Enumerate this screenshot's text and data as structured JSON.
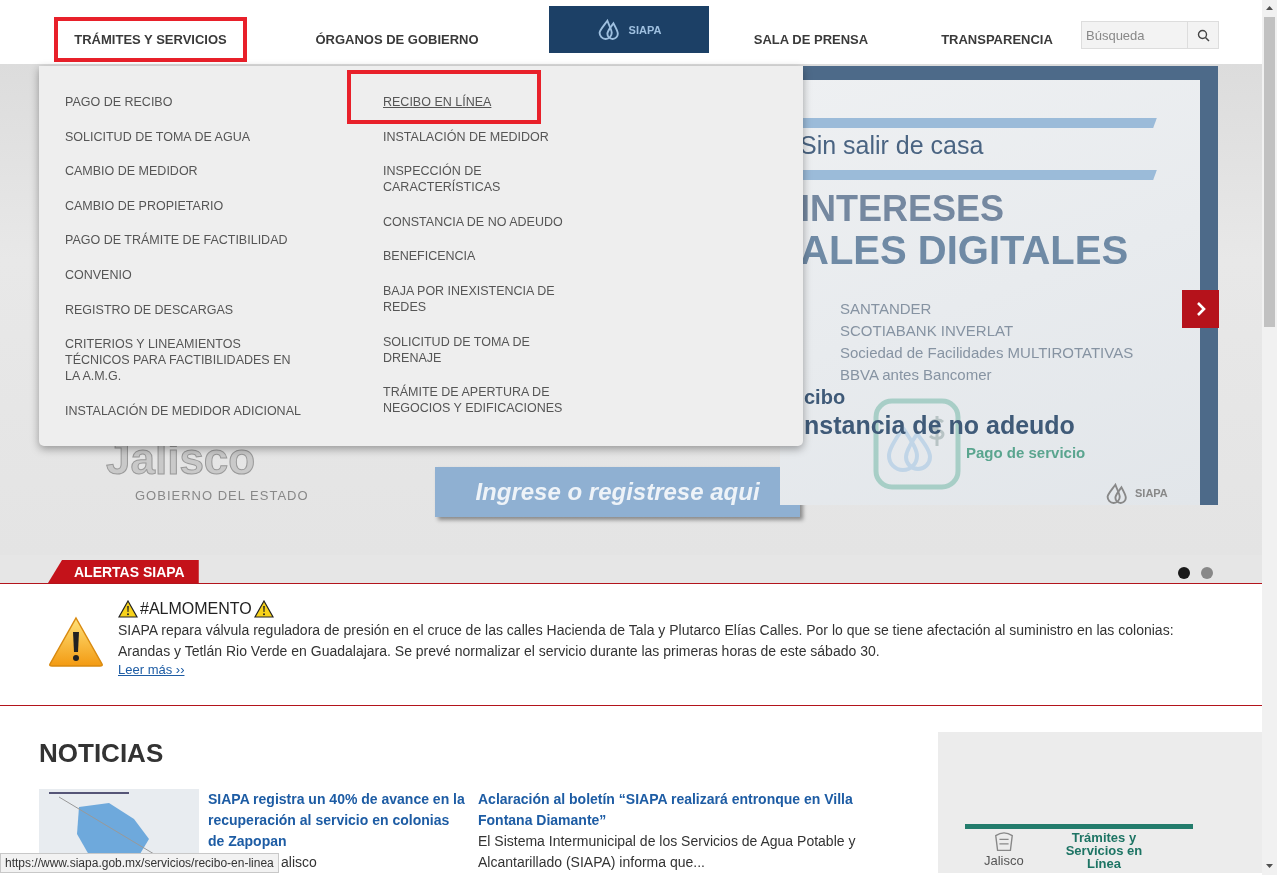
{
  "header": {
    "nav_left": [
      {
        "label": "TRÁMITES Y SERVICIOS",
        "highlighted": true
      },
      {
        "label": "ÓRGANOS DE GOBIERNO",
        "highlighted": false
      }
    ],
    "logo": {
      "text": "SIAPA"
    },
    "nav_right": [
      {
        "label": "SALA DE PRENSA",
        "highlighted": false
      },
      {
        "label": "TRANSPARENCIA",
        "highlighted": false
      }
    ],
    "search": {
      "placeholder": "Búsqueda"
    }
  },
  "dropdown_menu": {
    "columns": [
      [
        {
          "label": "PAGO DE RECIBO",
          "highlighted": false,
          "hovered": false
        },
        {
          "label": "SOLICITUD DE TOMA DE AGUA",
          "highlighted": false,
          "hovered": false
        },
        {
          "label": "CAMBIO DE MEDIDOR",
          "highlighted": false,
          "hovered": false
        },
        {
          "label": "CAMBIO DE PROPIETARIO",
          "highlighted": false,
          "hovered": false
        },
        {
          "label": "PAGO DE TRÁMITE DE FACTIBILIDAD",
          "highlighted": false,
          "hovered": false
        },
        {
          "label": "CONVENIO",
          "highlighted": false,
          "hovered": false
        },
        {
          "label": "REGISTRO DE DESCARGAS",
          "highlighted": false,
          "hovered": false
        },
        {
          "label": "CRITERIOS Y LINEAMIENTOS TÉCNICOS PARA FACTIBILIDADES EN LA A.M.G.",
          "highlighted": false,
          "hovered": false
        },
        {
          "label": "INSTALACIÓN DE MEDIDOR ADICIONAL",
          "highlighted": false,
          "hovered": false
        }
      ],
      [
        {
          "label": "RECIBO EN LÍNEA",
          "highlighted": true,
          "hovered": true
        },
        {
          "label": "INSTALACIÓN DE MEDIDOR",
          "highlighted": false,
          "hovered": false
        },
        {
          "label": "INSPECCIÓN DE CARACTERÍSTICAS",
          "highlighted": false,
          "hovered": false
        },
        {
          "label": "CONSTANCIA DE NO ADEUDO",
          "highlighted": false,
          "hovered": false
        },
        {
          "label": "BENEFICENCIA",
          "highlighted": false,
          "hovered": false
        },
        {
          "label": "BAJA POR INEXISTENCIA DE REDES",
          "highlighted": false,
          "hovered": false
        },
        {
          "label": "SOLICITUD DE TOMA DE DRENAJE",
          "highlighted": false,
          "hovered": false
        },
        {
          "label": "TRÁMITE DE APERTURA DE NEGOCIOS Y EDIFICACIONES",
          "highlighted": false,
          "hovered": false
        }
      ]
    ]
  },
  "banner": {
    "heading": "Sin salir de casa",
    "title_line_1": "INTERESES",
    "title_line_2": "ALES DIGITALES",
    "banks": [
      "SANTANDER",
      "SCOTIABANK INVERLAT",
      "Sociedad de Facilidades MULTIROTATIVAS",
      "BBVA  antes Bancomer"
    ],
    "caption_1": "cibo",
    "caption_2": "nstancia de no adeudo",
    "service_label": "Pago de servicio",
    "footer_logo": "SIAPA",
    "partner_logo": "Jalisco",
    "partner_caption": "GOBIERNO DEL ESTADO",
    "cta": "Ingrese o registrese aqui"
  },
  "carousel_dots": [
    {
      "selected": true
    },
    {
      "selected": false
    }
  ],
  "alerts": {
    "tab": "ALERTAS SIAPA",
    "title": "#ALMOMENTO",
    "body": "SIAPA repara válvula reguladora de presión en el cruce de las calles Hacienda de Tala y Plutarco Elías Calles. Por lo que se tiene afectación al suministro en las colonias: Arandas y Tetlán Rio Verde en Guadalajara. Se prevé normalizar el servicio durante las primeras horas de este sábado 30.",
    "link": "Leer más ››"
  },
  "news": {
    "heading": "NOTICIAS",
    "articles": [
      {
        "title": "SIAPA registra un 40% de avance en la recuperación al servicio en colonias de Zapopan",
        "excerpt": "alisco"
      },
      {
        "title": "Aclaración al boletín “SIAPA realizará entronque en Villa Fontana Diamante”",
        "excerpt": "El Sistema Intermunicipal de los Servicios de Agua Potable y Alcantarillado (SIAPA) informa que..."
      }
    ]
  },
  "side_card": {
    "logo": "Jalisco",
    "title": "Trámites y Servicios en Línea"
  },
  "status_url": "https://www.siapa.gob.mx/servicios/recibo-en-linea"
}
